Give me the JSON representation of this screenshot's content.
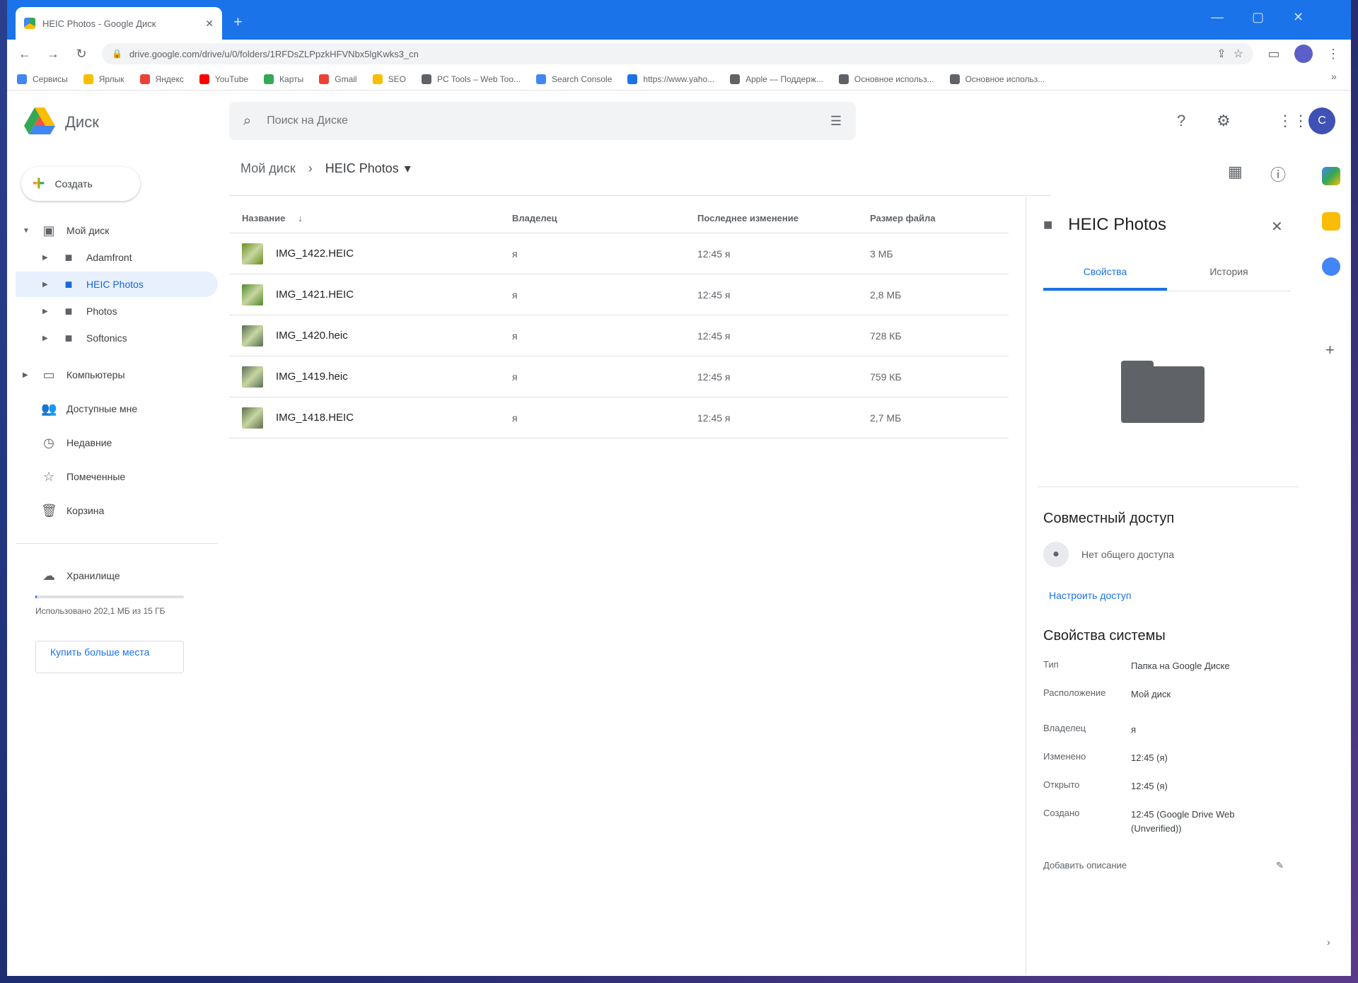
{
  "browser": {
    "tab_title": "HEIC Photos - Google Диск",
    "tab_close": "✕",
    "new_tab": "+",
    "url": "drive.google.com/drive/u/0/folders/1RFDsZLPpzkHFVNbx5lgKwks3_cn",
    "bookmarks": [
      {
        "label": "Сервисы",
        "color": "#4285f4"
      },
      {
        "label": "Ярлык",
        "color": "#fbbc04"
      },
      {
        "label": "Яндекс",
        "color": "#ea4335"
      },
      {
        "label": "YouTube",
        "color": "#ff0000"
      },
      {
        "label": "Карты",
        "color": "#34a853"
      },
      {
        "label": "Gmail",
        "color": "#ea4335"
      },
      {
        "label": "SEO",
        "color": "#fbbc04"
      },
      {
        "label": "PC Tools – Web Too...",
        "color": "#5f6368"
      },
      {
        "label": "Search Console",
        "color": "#4285f4"
      },
      {
        "label": "https://www.yaho...",
        "color": "#1a73e8"
      },
      {
        "label": "Apple — Поддерж...",
        "color": "#5f6368"
      },
      {
        "label": "Основное использ...",
        "color": "#5f6368"
      },
      {
        "label": "Основное использ...",
        "color": "#5f6368"
      }
    ]
  },
  "app": {
    "name": "Диск",
    "search_placeholder": "Поиск на Диске",
    "avatar_letter": "C"
  },
  "sidebar": {
    "create_label": "Создать",
    "tree": [
      {
        "label": "Мой диск",
        "icon": "drive-icon",
        "arrow": "▼"
      },
      {
        "label": "Adamfront",
        "icon": "folder-icon",
        "arrow": "▶"
      },
      {
        "label": "HEIC Photos",
        "icon": "folder-icon",
        "arrow": "▶",
        "active": true
      },
      {
        "label": "Photos",
        "icon": "folder-icon",
        "arrow": "▶"
      },
      {
        "label": "Softonics",
        "icon": "folder-icon",
        "arrow": "▶"
      }
    ],
    "nav": [
      {
        "label": "Компьютеры",
        "icon": "computer-icon",
        "arrow": "▶"
      },
      {
        "label": "Доступные мне",
        "icon": "people-icon",
        "arrow": ""
      },
      {
        "label": "Недавние",
        "icon": "clock-icon",
        "arrow": ""
      },
      {
        "label": "Помеченные",
        "icon": "star-icon",
        "arrow": ""
      },
      {
        "label": "Корзина",
        "icon": "trash-icon",
        "arrow": ""
      }
    ],
    "storage_label": "Хранилище",
    "storage_used_fraction": 0.01,
    "storage_text": "Использовано 202,1 МБ из 15 ГБ",
    "buy_label": "Купить больше места"
  },
  "main": {
    "breadcrumb_root": "Мой диск",
    "breadcrumb_current": "HEIC Photos",
    "columns": {
      "name": "Название",
      "owner": "Владелец",
      "modified": "Последнее изменение",
      "size": "Размер файла"
    },
    "files": [
      {
        "name": "IMG_1422.HEIC",
        "owner": "я",
        "modified": "12:45 я",
        "size": "3 МБ",
        "thumb": "#6b8e23"
      },
      {
        "name": "IMG_1421.HEIC",
        "owner": "я",
        "modified": "12:45 я",
        "size": "2,8 МБ",
        "thumb": "#4f8a2b"
      },
      {
        "name": "IMG_1420.heic",
        "owner": "я",
        "modified": "12:45 я",
        "size": "728 КБ",
        "thumb": "#556b55"
      },
      {
        "name": "IMG_1419.heic",
        "owner": "я",
        "modified": "12:45 я",
        "size": "759 КБ",
        "thumb": "#5a6f5a"
      },
      {
        "name": "IMG_1418.HEIC",
        "owner": "я",
        "modified": "12:45 я",
        "size": "2,7 МБ",
        "thumb": "#5e6e4e"
      }
    ]
  },
  "details": {
    "title": "HEIC Photos",
    "tabs": [
      "Свойства",
      "История"
    ],
    "sharing_title": "Совместный доступ",
    "sharing_status": "Нет общего доступа",
    "sharing_link": "Настроить доступ",
    "system_title": "Свойства системы",
    "props": [
      {
        "k": "Тип",
        "v": "Папка на Google Диске"
      },
      {
        "k": "Расположение",
        "v": "Мой диск"
      },
      {
        "k": "Владелец",
        "v": "я"
      },
      {
        "k": "Изменено",
        "v": "12:45 (я)"
      },
      {
        "k": "Открыто",
        "v": "12:45 (я)"
      },
      {
        "k": "Создано",
        "v": "12:45 (Google Drive Web (Unverified))"
      }
    ],
    "description_placeholder": "Добавить описание"
  }
}
